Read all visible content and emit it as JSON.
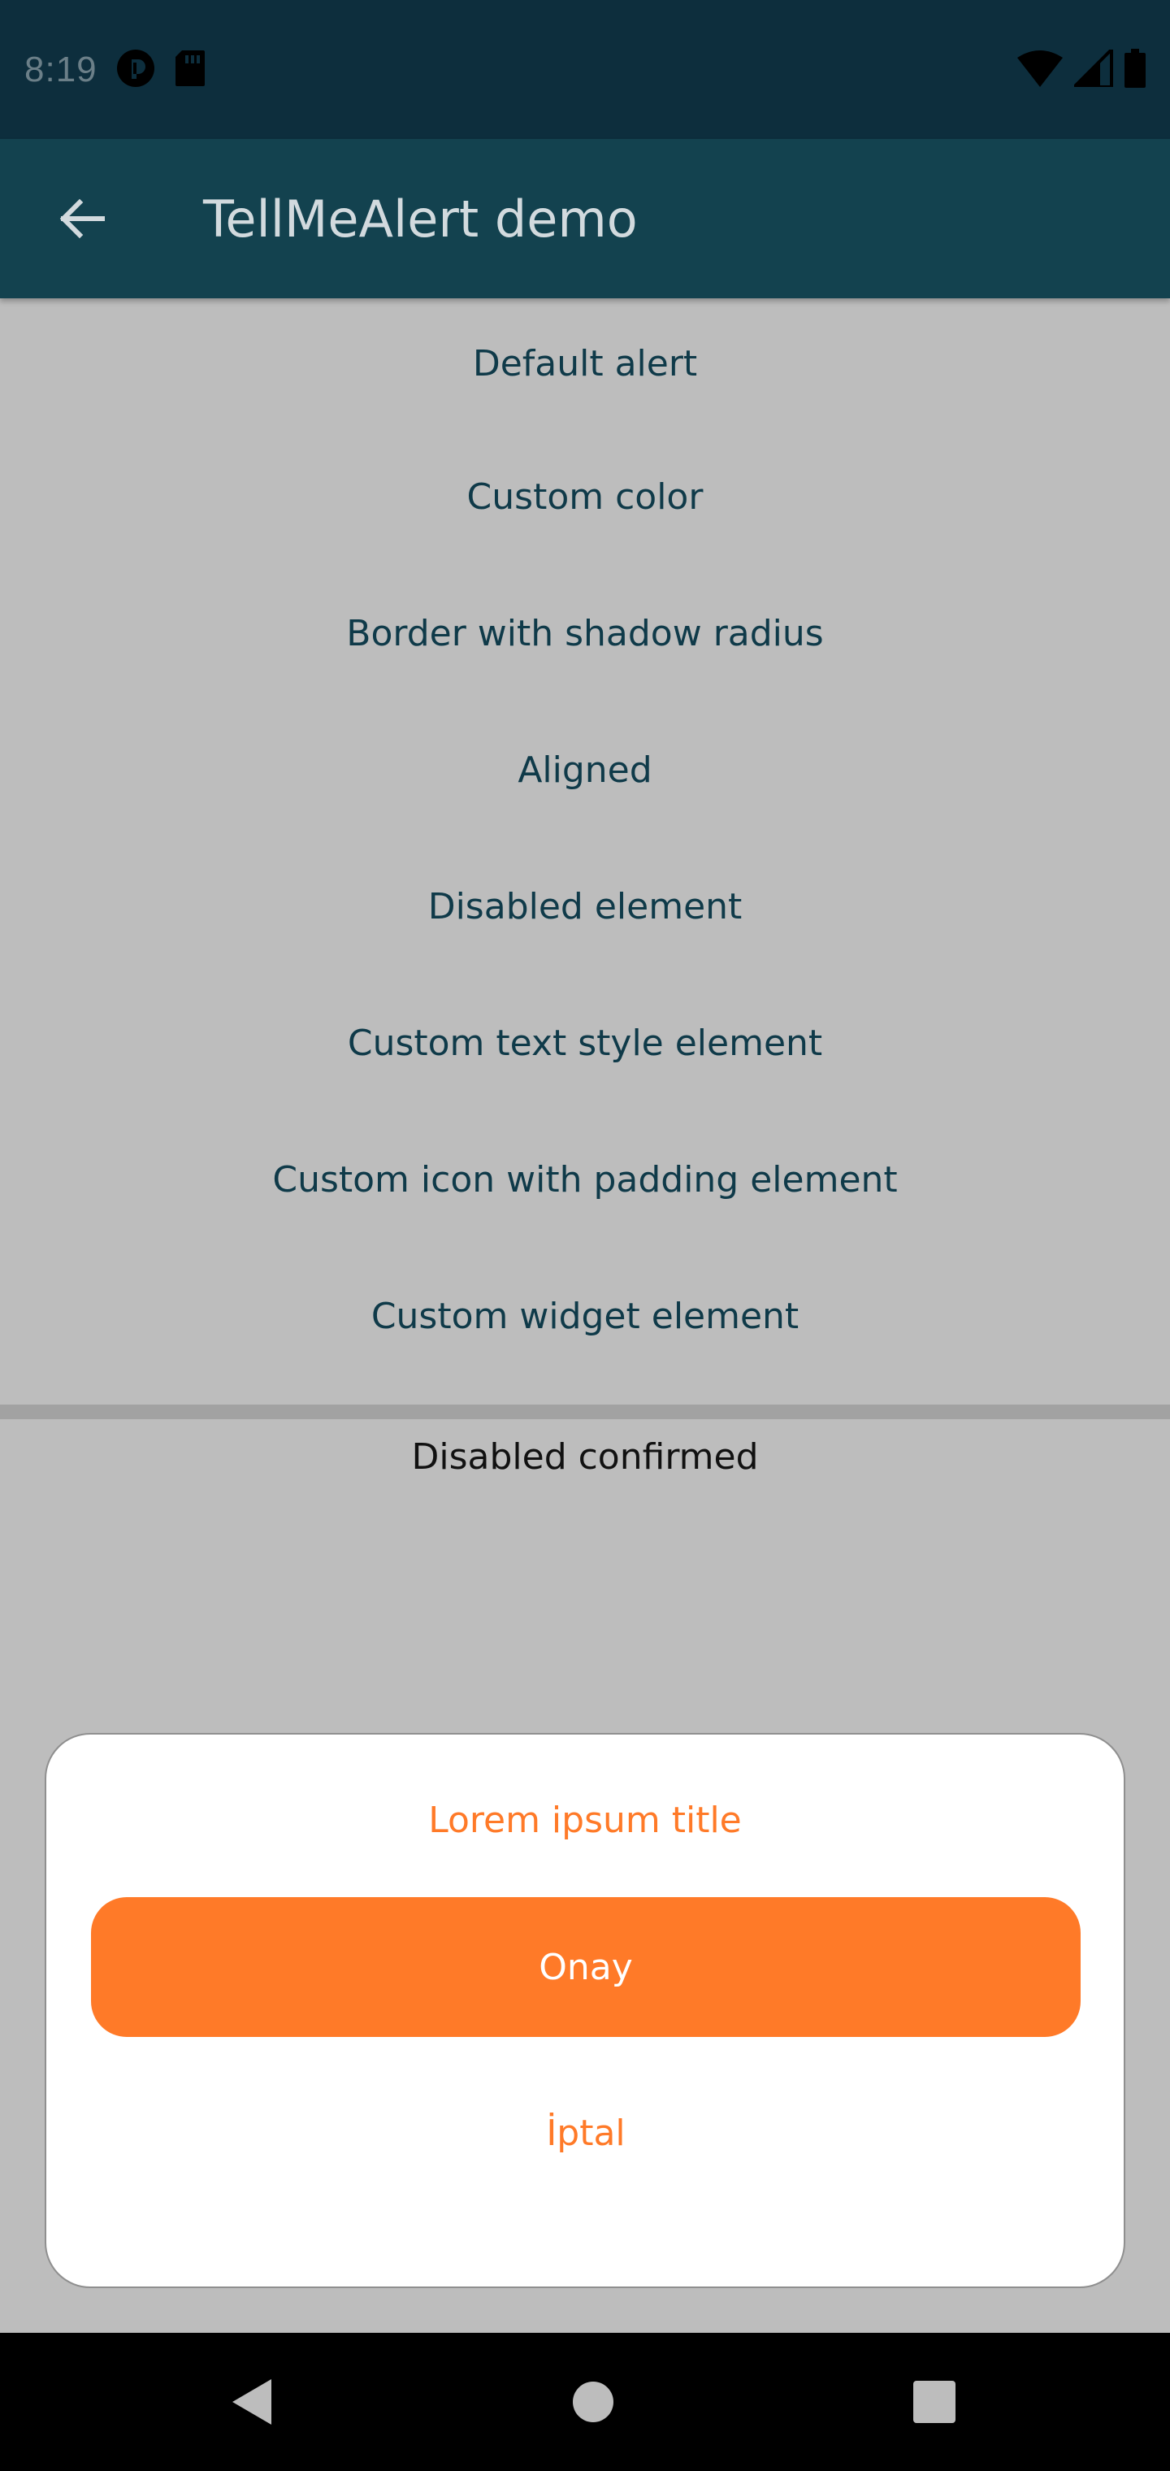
{
  "status_bar": {
    "time": "8:19",
    "icons_left": [
      "pocket-icon",
      "sd-card-icon"
    ],
    "icons_right": [
      "wifi-icon",
      "signal-icon",
      "battery-icon"
    ]
  },
  "app_bar": {
    "title": "TellMeAlert demo",
    "back_icon": "arrow-back-icon"
  },
  "list": {
    "items": [
      "Default alert",
      "Custom color",
      "Border with shadow radius",
      "Aligned",
      "Disabled element",
      "Custom text style element",
      "Custom icon with padding element",
      "Custom widget element"
    ]
  },
  "status_text": "Disabled confirmed",
  "dialog": {
    "title": "Lorem ipsum title",
    "confirm_label": "Onay",
    "cancel_label": "İptal"
  },
  "nav_bar": {
    "icons": [
      "nav-back-icon",
      "nav-home-icon",
      "nav-recents-icon"
    ]
  },
  "colors": {
    "status_bar": "#0d2e3d",
    "app_bar": "#13424f",
    "scrim_background": "#bdbdbd",
    "list_text": "#0f3a49",
    "accent": "#ff7a28"
  }
}
